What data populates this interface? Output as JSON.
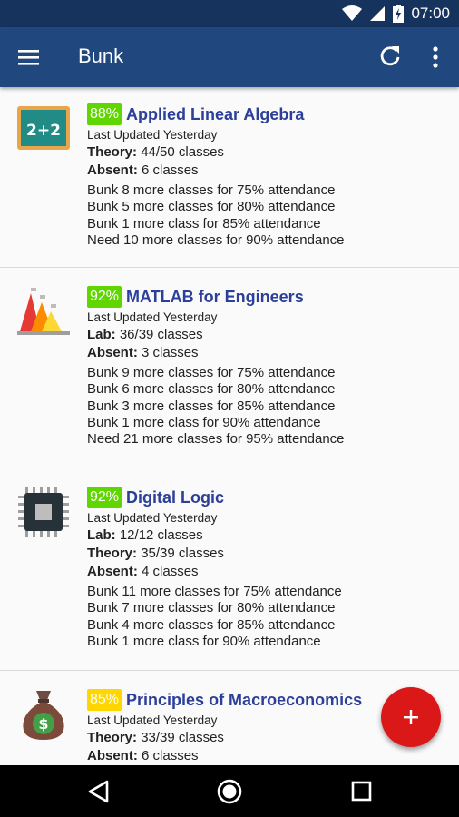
{
  "status": {
    "time": "07:00"
  },
  "appbar": {
    "title": "Bunk"
  },
  "cards": [
    {
      "percent": "88%",
      "subject": "Applied Linear Algebra",
      "updated_label": "Last Updated",
      "updated_value": "Yesterday",
      "rows": [
        {
          "label": "Theory:",
          "value": "44/50 classes"
        },
        {
          "label": "Absent:",
          "value": "6 classes"
        }
      ],
      "bunks": [
        "Bunk 8 more classes for 75% attendance",
        "Bunk 5 more classes for 80% attendance",
        "Bunk 1 more class for 85% attendance",
        "Need 10 more classes for 90% attendance"
      ]
    },
    {
      "percent": "92%",
      "subject": "MATLAB for Engineers",
      "updated_label": "Last Updated",
      "updated_value": "Yesterday",
      "rows": [
        {
          "label": "Lab:",
          "value": "36/39 classes"
        },
        {
          "label": "Absent:",
          "value": "3 classes"
        }
      ],
      "bunks": [
        "Bunk 9 more classes for 75% attendance",
        "Bunk 6 more classes for 80% attendance",
        "Bunk 3 more classes for 85% attendance",
        "Bunk 1 more class for 90% attendance",
        "Need 21 more classes for 95% attendance"
      ]
    },
    {
      "percent": "92%",
      "subject": "Digital Logic",
      "updated_label": "Last Updated",
      "updated_value": "Yesterday",
      "rows": [
        {
          "label": "Lab:",
          "value": "12/12 classes"
        },
        {
          "label": "Theory:",
          "value": "35/39 classes"
        },
        {
          "label": "Absent:",
          "value": "4 classes"
        }
      ],
      "bunks": [
        "Bunk 11 more classes for 75% attendance",
        "Bunk 7 more classes for 80% attendance",
        "Bunk 4 more classes for 85% attendance",
        "Bunk 1 more class for 90% attendance"
      ]
    },
    {
      "percent": "85%",
      "subject": "Principles of Macroeconomics",
      "updated_label": "Last Updated",
      "updated_value": "Yesterday",
      "rows": [
        {
          "label": "Theory:",
          "value": "33/39 classes"
        },
        {
          "label": "Absent:",
          "value": "6 classes"
        }
      ],
      "bunks": []
    }
  ],
  "card_icons": [
    "chalkboard-icon",
    "matlab-icon",
    "chip-icon",
    "money-bag-icon"
  ],
  "card_percent_colors": [
    "#5fd600",
    "#5fd600",
    "#5fd600",
    "#ffd600"
  ],
  "colors": {
    "statusbar": "#16335e",
    "appbar": "#20477e",
    "subject_text": "#2c3f9a",
    "fab": "#db1818",
    "percent_good": "#5fd600",
    "percent_warn": "#ffd600"
  }
}
